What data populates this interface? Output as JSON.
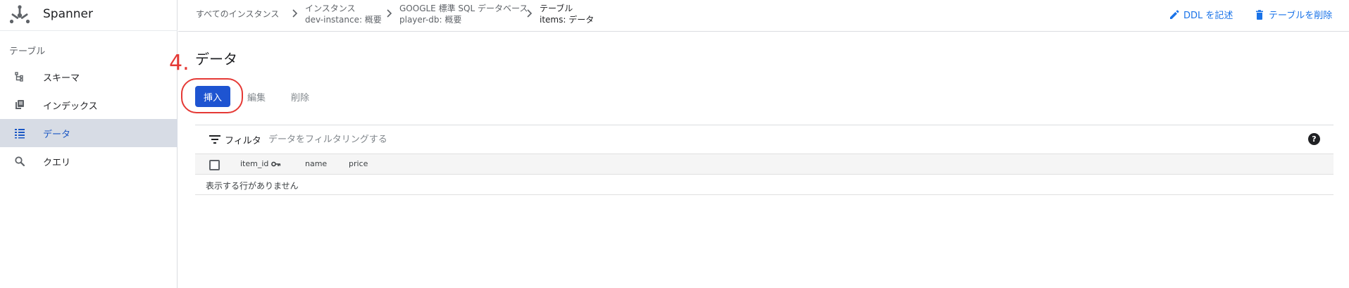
{
  "app": {
    "name": "Spanner"
  },
  "sidebar": {
    "section_label": "テーブル",
    "items": [
      {
        "label": "スキーマ",
        "icon": "schema-icon",
        "active": false
      },
      {
        "label": "インデックス",
        "icon": "index-icon",
        "active": false
      },
      {
        "label": "データ",
        "icon": "data-grid-icon",
        "active": true
      },
      {
        "label": "クエリ",
        "icon": "search-icon",
        "active": false
      }
    ]
  },
  "breadcrumb": {
    "all_instances": "すべてのインスタンス",
    "instance_title": "インスタンス",
    "instance_value": "dev-instance: 概要",
    "database_title": "GOOGLE 標準 SQL データベース",
    "database_value": "player-db: 概要",
    "table_title": "テーブル",
    "table_value": "items: データ"
  },
  "header_actions": {
    "write_ddl": "DDL を記述",
    "delete_table": "テーブルを削除"
  },
  "main": {
    "title": "データ",
    "step_annotation": "4.",
    "buttons": {
      "insert": "挿入",
      "edit": "編集",
      "delete": "削除"
    }
  },
  "filter": {
    "label": "フィルタ",
    "placeholder": "データをフィルタリングする",
    "help": "?"
  },
  "table": {
    "columns": [
      "item_id",
      "name",
      "price"
    ],
    "primary_key_column": "item_id",
    "empty_message": "表示する行がありません"
  },
  "colors": {
    "primary": "#1e54d1",
    "link": "#1a73e8",
    "annotation": "#e53935",
    "active_nav_bg": "#d7dce5"
  }
}
